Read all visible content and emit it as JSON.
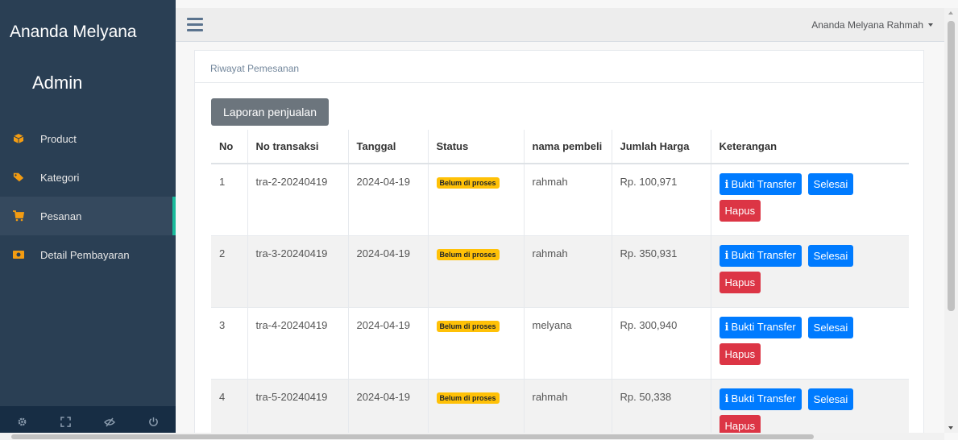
{
  "sidebar": {
    "brand": "Ananda Melyana",
    "role": "Admin",
    "items": [
      {
        "label": "Product",
        "icon": "cube-icon",
        "icon_color": "#f39c12"
      },
      {
        "label": "Kategori",
        "icon": "tags-icon",
        "icon_color": "#f39c12"
      },
      {
        "label": "Pesanan",
        "icon": "cart-icon",
        "icon_color": "#f39c12",
        "active": true
      },
      {
        "label": "Detail Pembayaran",
        "icon": "money-icon",
        "icon_color": "#f39c12"
      }
    ],
    "footer_icons": [
      "gear-icon",
      "fullscreen-icon",
      "eye-slash-icon",
      "power-icon"
    ]
  },
  "topbar": {
    "user_name": "Ananda Melyana Rahmah"
  },
  "panel": {
    "title": "Riwayat Pemesanan",
    "report_button": "Laporan penjualan",
    "columns": [
      "No",
      "No transaksi",
      "Tanggal",
      "Status",
      "nama pembeli",
      "Jumlah Harga",
      "Keterangan"
    ],
    "rows": [
      {
        "no": "1",
        "trx": "tra-2-20240419",
        "date": "2024-04-19",
        "status": "Belum di proses",
        "buyer": "rahmah",
        "total": "Rp. 100,971"
      },
      {
        "no": "2",
        "trx": "tra-3-20240419",
        "date": "2024-04-19",
        "status": "Belum di proses",
        "buyer": "rahmah",
        "total": "Rp. 350,931"
      },
      {
        "no": "3",
        "trx": "tra-4-20240419",
        "date": "2024-04-19",
        "status": "Belum di proses",
        "buyer": "melyana",
        "total": "Rp. 300,940"
      },
      {
        "no": "4",
        "trx": "tra-5-20240419",
        "date": "2024-04-19",
        "status": "Belum di proses",
        "buyer": "rahmah",
        "total": "Rp. 50,338"
      }
    ],
    "actions": {
      "transfer": "Bukti Transfer",
      "done": "Selesai",
      "delete": "Hapus"
    }
  },
  "colors": {
    "sidebar_bg": "#2a3f54",
    "accent": "#1abb9c",
    "primary": "#007bff",
    "danger": "#dc3545",
    "warning": "#ffc107"
  }
}
